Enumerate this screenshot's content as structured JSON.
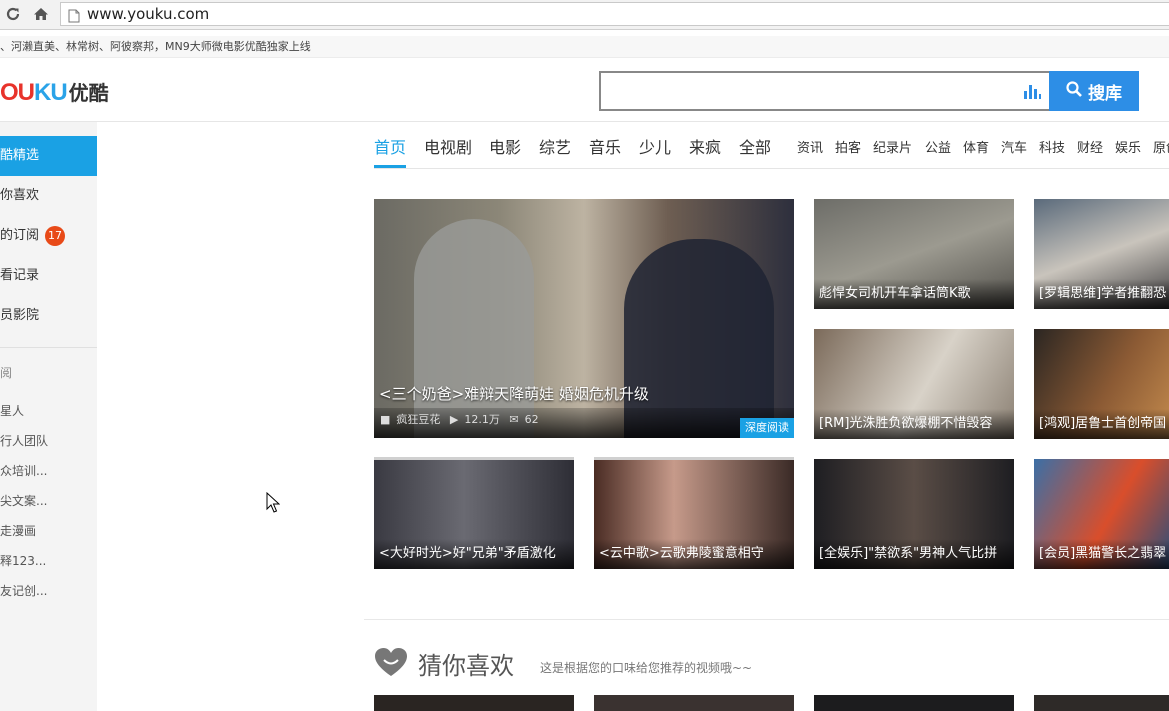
{
  "browser": {
    "url": "www.youku.com"
  },
  "ticker": {
    "text": "、河濑直美、林常树、阿彼察邦，MN9大师微电影优酷独家上线"
  },
  "header": {
    "logo_en_a": "OU",
    "logo_en_b": "KU",
    "logo_cn": "优酷",
    "search_placeholder": "",
    "search_button": "搜库"
  },
  "sidebar": {
    "items": [
      {
        "label": "酷精选"
      },
      {
        "label": "你喜欢"
      },
      {
        "label": "的订阅",
        "badge": "17"
      },
      {
        "label": "看记录"
      },
      {
        "label": "员影院"
      }
    ],
    "sub_header": "阅",
    "subs": [
      "星人",
      "行人团队",
      "众培训...",
      "尖文案...",
      "走漫画",
      "释123...",
      "友记创..."
    ]
  },
  "nav": {
    "main": [
      "首页",
      "电视剧",
      "电影",
      "综艺",
      "音乐",
      "少儿",
      "来疯",
      "全部"
    ],
    "small": [
      "资讯",
      "拍客",
      "纪录片",
      "公益",
      "体育",
      "汽车",
      "科技",
      "财经",
      "娱乐",
      "原创"
    ]
  },
  "hero": {
    "title": "<三个奶爸>难辩天降萌娃 婚姻危机升级",
    "uploader": "疯狂豆花",
    "views": "12.1万",
    "comments": "62",
    "tag": "深度阅读"
  },
  "tiles": [
    {
      "title": "彪悍女司机开车拿话筒K歌"
    },
    {
      "title": "[罗辑思维]学者推翻恐"
    },
    {
      "title": "[RM]光洙胜负欲爆棚不惜毁容"
    },
    {
      "title": "[鸿观]居鲁士首创帝国"
    },
    {
      "title": "<大好时光>好\"兄弟\"矛盾激化"
    },
    {
      "title": "<云中歌>云歌弗陵蜜意相守"
    },
    {
      "title": "[全娱乐]\"禁欲系\"男神人气比拼"
    },
    {
      "title": "[会员]黑猫警长之翡翠"
    }
  ],
  "guess": {
    "title": "猜你喜欢",
    "subtitle": "这是根据您的口味给您推荐的视频哦~~"
  }
}
